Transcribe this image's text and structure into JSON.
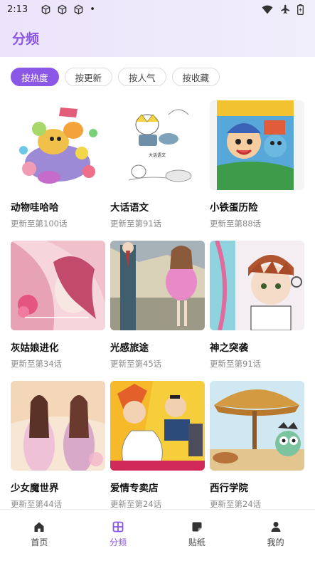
{
  "status_bar": {
    "time": "2:13",
    "dot": "•",
    "left_icons": [
      "cube-icon",
      "cube-icon",
      "cube-icon"
    ],
    "right_icons": [
      "wifi-icon",
      "airplane-icon",
      "battery-icon"
    ]
  },
  "header": {
    "title": "分频"
  },
  "tabs": [
    {
      "label": "按热度",
      "active": true
    },
    {
      "label": "按更新",
      "active": false
    },
    {
      "label": "按人气",
      "active": false
    },
    {
      "label": "按收藏",
      "active": false
    }
  ],
  "comics": [
    {
      "title": "动物哇哈哈",
      "update": "更新至第100话"
    },
    {
      "title": "大话语文",
      "update": "更新至第91话",
      "cover_text": "大话语文"
    },
    {
      "title": "小铁蛋历险",
      "update": "更新至第88话"
    },
    {
      "title": "灰姑娘进化",
      "update": "更新至第34话"
    },
    {
      "title": "光感旅途",
      "update": "更新至第45话"
    },
    {
      "title": "神之突袭",
      "update": "更新至第91话"
    },
    {
      "title": "少女魔世界",
      "update": "更新至第44话"
    },
    {
      "title": "爱情专卖店",
      "update": "更新至第24话"
    },
    {
      "title": "西行学院",
      "update": "更新至第24话"
    }
  ],
  "bottom_nav": [
    {
      "label": "首页",
      "icon": "home-icon",
      "active": false
    },
    {
      "label": "分频",
      "icon": "grid-icon",
      "active": true
    },
    {
      "label": "贴纸",
      "icon": "sticker-icon",
      "active": false
    },
    {
      "label": "我的",
      "icon": "person-icon",
      "active": false
    }
  ],
  "colors": {
    "accent": "#8a57e6",
    "header_bg": "#ede6fb",
    "muted_text": "#8a8a8a"
  }
}
